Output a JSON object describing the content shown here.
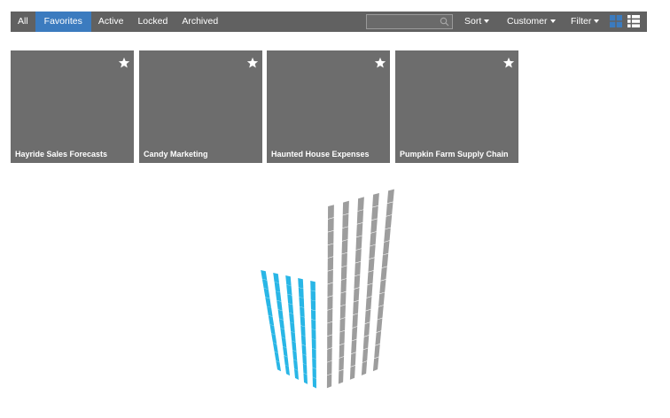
{
  "toolbar": {
    "tabs": [
      "All",
      "Favorites",
      "Active",
      "Locked",
      "Archived"
    ],
    "active_tab": "Favorites",
    "search": {
      "value": "",
      "placeholder": "",
      "icon": "search-icon"
    },
    "sort_label": "Sort",
    "customer_label": "Customer",
    "filter_label": "Filter",
    "view_modes": [
      "grid-view-icon",
      "list-view-icon"
    ],
    "active_view": "grid-view-icon",
    "colors": {
      "bar": "#616161",
      "active": "#3b7bbf",
      "text": "#ffffff"
    }
  },
  "cards": [
    {
      "title": "Hayride Sales Forecasts",
      "favorite": true,
      "icon": "star-icon"
    },
    {
      "title": "Candy Marketing",
      "favorite": true,
      "icon": "star-icon"
    },
    {
      "title": "Haunted House Expenses",
      "favorite": true,
      "icon": "star-icon"
    },
    {
      "title": "Pumpkin Farm Supply Chain",
      "favorite": true,
      "icon": "star-icon"
    }
  ],
  "card_color": "#6d6d6d",
  "logo": {
    "icon": "building-logo-icon",
    "colors": {
      "blue": "#29b6e6",
      "gray": "#9d9d9d"
    }
  }
}
